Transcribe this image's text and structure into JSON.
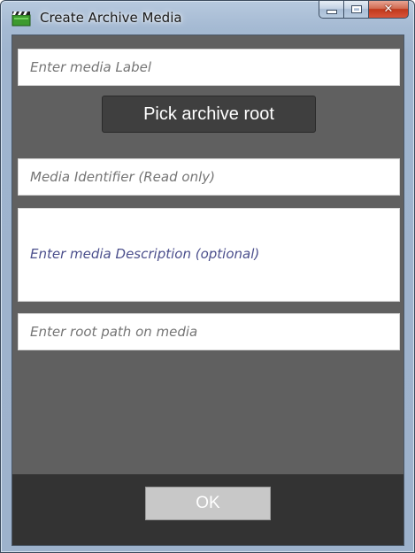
{
  "window": {
    "title": "Create Archive Media",
    "icon": "clapperboard-icon",
    "caption_buttons": {
      "minimize": "minimize-icon",
      "maximize": "maximize-icon",
      "close": "close-icon"
    }
  },
  "form": {
    "media_label": {
      "value": "",
      "placeholder": "Enter media Label"
    },
    "pick_root_label": "Pick archive root",
    "media_identifier": {
      "value": "",
      "placeholder": "Media Identifier (Read only)"
    },
    "media_description": {
      "value": "",
      "placeholder": "Enter media Description (optional)"
    },
    "root_path": {
      "value": "",
      "placeholder": "Enter root path on media"
    }
  },
  "footer": {
    "ok_label": "OK"
  },
  "colors": {
    "client_background": "#606060",
    "footer_background": "#333333",
    "pick_button_background": "#3f3f3f",
    "ok_button_background": "#c8c8c8",
    "placeholder_text": "#4b4f8c"
  }
}
